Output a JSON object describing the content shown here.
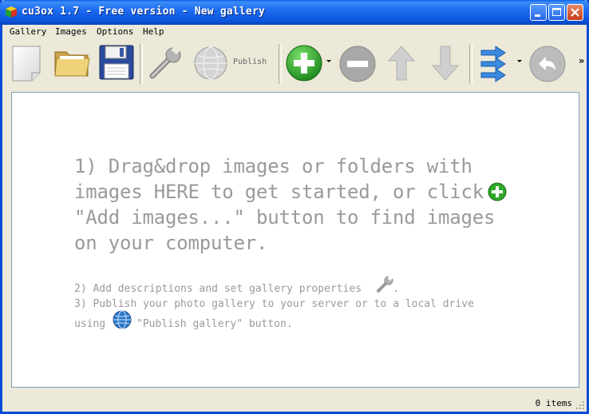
{
  "window": {
    "title": "cu3ox 1.7 - Free version - New gallery"
  },
  "menu": [
    "Gallery",
    "Images",
    "Options",
    "Help"
  ],
  "toolbar": {
    "publish_label": "Publish",
    "overflow": "»"
  },
  "canvas": {
    "line1": "1) Drag&drop images or folders with",
    "line2": "images HERE to get started, or click",
    "line3": "\"Add images...\" button to find images",
    "line4": "on your computer.",
    "line5": "2) Add descriptions and set gallery properties",
    "line5_end": ".",
    "line6": "3) Publish your photo gallery to your server or to a local drive",
    "line7_start": "using",
    "line7_end": "\"Publish gallery\" button."
  },
  "status": {
    "items": "0 items"
  },
  "colors": {
    "title_bar": "#0a54dc",
    "add_green": "#2fa82a",
    "hint_text": "#9a9a9a"
  }
}
